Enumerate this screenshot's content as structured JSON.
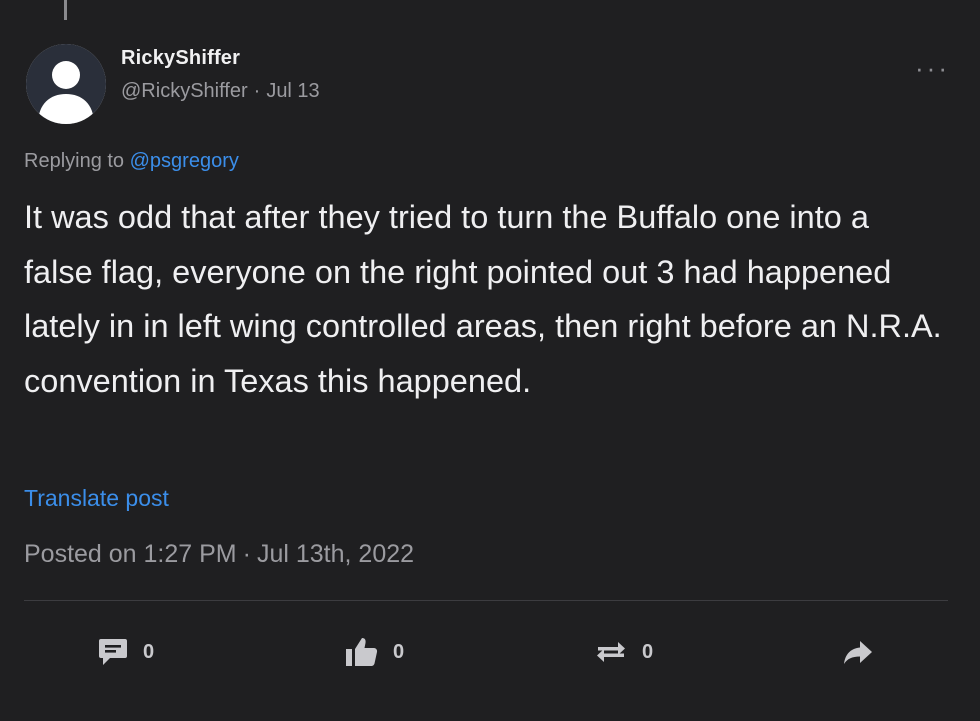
{
  "post": {
    "display_name": "RickyShiffer",
    "handle": "@RickyShiffer",
    "separator": "·",
    "date_short": "Jul 13",
    "more_label": "···",
    "replying_prefix": "Replying to",
    "replying_to": "@psgregory",
    "body": "It was odd that after they tried to turn the Buffalo one into a false flag, everyone on the right pointed out 3 had happened lately in in left wing controlled areas, then right before an N.R.A. convention in Texas this happened.",
    "translate_label": "Translate post",
    "posted_prefix": "Posted on 1:27 PM",
    "posted_date": "Jul 13th, 2022"
  },
  "actions": {
    "comments": "0",
    "likes": "0",
    "reposts": "0",
    "share_icon": "share-arrow-icon"
  },
  "colors": {
    "background": "#1f1f21",
    "link": "#3b8eea",
    "text": "#efeff1",
    "muted": "#9b9ba0"
  }
}
